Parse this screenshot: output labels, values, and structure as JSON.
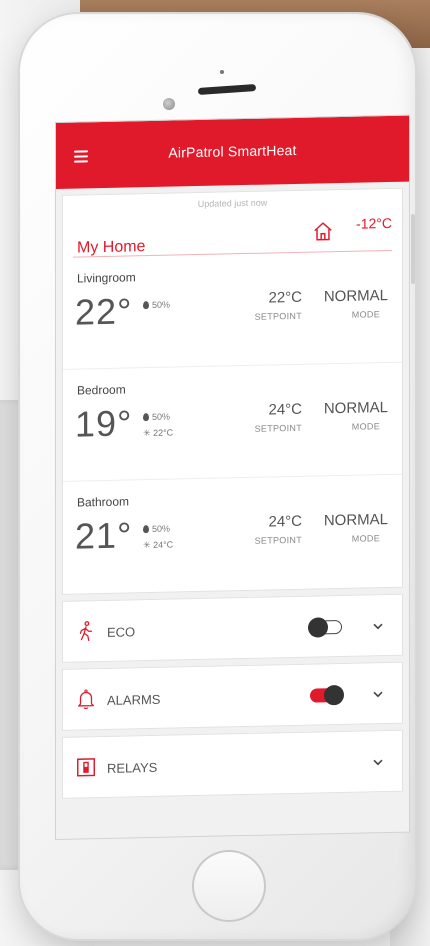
{
  "app": {
    "title": "AirPatrol SmartHeat",
    "updated": "Updated just now"
  },
  "home": {
    "name": "My Home",
    "outside_temp": "-12°C"
  },
  "rooms": [
    {
      "name": "Livingroom",
      "temp": "22°",
      "humidity": "50%",
      "frost": "",
      "setpoint": "22°C",
      "mode": "NORMAL",
      "setpoint_label": "SETPOINT",
      "mode_label": "MODE"
    },
    {
      "name": "Bedroom",
      "temp": "19°",
      "humidity": "50%",
      "frost": "22°C",
      "setpoint": "24°C",
      "mode": "NORMAL",
      "setpoint_label": "SETPOINT",
      "mode_label": "MODE"
    },
    {
      "name": "Bathroom",
      "temp": "21°",
      "humidity": "50%",
      "frost": "24°C",
      "setpoint": "24°C",
      "mode": "NORMAL",
      "setpoint_label": "SETPOINT",
      "mode_label": "MODE"
    }
  ],
  "options": [
    {
      "label": "ECO",
      "icon": "walking-person-icon",
      "toggle": "off"
    },
    {
      "label": "ALARMS",
      "icon": "bell-icon",
      "toggle": "on"
    },
    {
      "label": "RELAYS",
      "icon": "relay-switch-icon",
      "toggle": "none"
    }
  ],
  "colors": {
    "accent": "#e01a2b",
    "text": "#555555"
  }
}
